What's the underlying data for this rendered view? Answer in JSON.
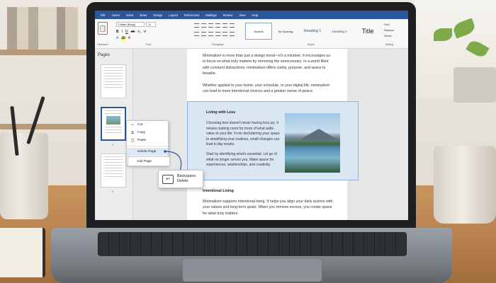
{
  "menu": [
    "File",
    "Home",
    "Insert",
    "Draw",
    "Design",
    "Layout",
    "References",
    "Mailings",
    "Review",
    "View",
    "Help"
  ],
  "ribbon": {
    "clipboard_label": "Clipboard",
    "paste_label": "Paste",
    "cut_label": "Cut",
    "copy_label": "Copy",
    "font_name": "Calibri (Body)",
    "font_size": "11",
    "font_group": "Font",
    "paragraph_group": "Paragraph",
    "styles_group": "Styles",
    "editing_group": "Editing",
    "styles": [
      "Normal",
      "No Spacing",
      "Heading 1",
      "Heading 2",
      "Title"
    ],
    "find": "Find",
    "replace": "Replace",
    "select": "Select"
  },
  "pages_pane": {
    "title": "Pages",
    "page_numbers": [
      "1",
      "2",
      "3"
    ]
  },
  "document": {
    "para1": "Minimalism is more than just a design trend—it's a mindset. It encourages us to focus on what truly matters by removing the senecessary. In a world filled with constant distractions, minimalism offers clarity, purpose, and space to breathe.",
    "para2": "Whether applied to your home, your schedule, or your digital life, minimalism can lead to more intentional choices and a greater sense of peace.",
    "section_heading": "Living with Less",
    "section_para1": "Choosing less doesn't mean having less joy. It means making room for more of what adds value to your life. From decluttering your space to simplifying your routines, small changes can lead to big results.",
    "section_para2": "Start by identifying what's essential. Let go of what no longer serves you. Make space for experiences, relationships, and creativity.",
    "heading2": "Intentional Living",
    "para3": "Minimalism supports intentional living. It helps you align your daily actions with your values and long-term goals. When you remove excess, you create space for what truly matters."
  },
  "context_menu": {
    "cut": "Cut",
    "copy": "Copy",
    "paste": "Paste",
    "delete_page": "Delete Page",
    "add_page": "Add Page"
  },
  "key_tip": {
    "backspace": "Backspace",
    "delete": "Delete"
  },
  "colors": {
    "accent": "#2b579a",
    "selection": "#dbe6f4"
  }
}
